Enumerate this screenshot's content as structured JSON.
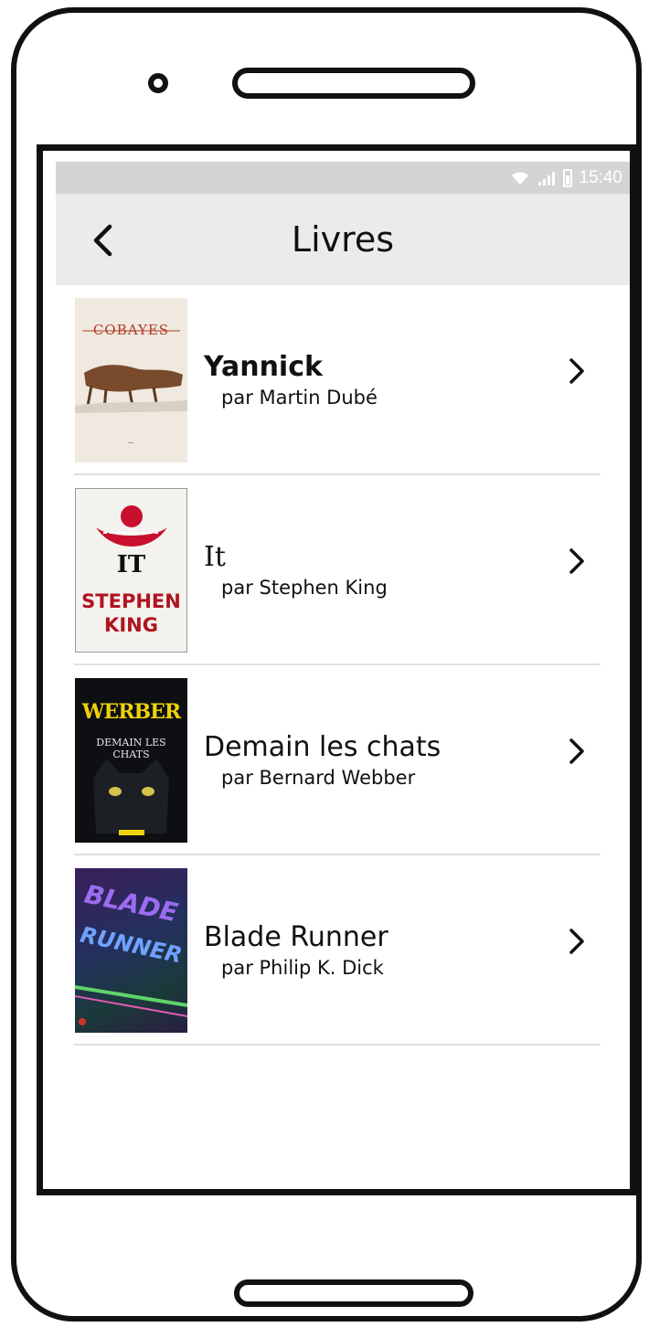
{
  "status_bar": {
    "time": "15:40",
    "icons": [
      "wifi-icon",
      "signal-icon",
      "battery-icon"
    ]
  },
  "app_bar": {
    "title": "Livres",
    "back_icon": "chevron-left-icon"
  },
  "books": [
    {
      "title": "Yannick",
      "author": "par Martin Dubé",
      "cover_text": "COBAYES"
    },
    {
      "title": "It",
      "author": "par Stephen King",
      "cover_text_top": "IT",
      "cover_text_bottom": "STEPHEN KING"
    },
    {
      "title": "Demain les chats",
      "author": "par Bernard Webber",
      "cover_text_top": "WERBER",
      "cover_text_bottom": "DEMAIN LES CHATS"
    },
    {
      "title": "Blade Runner",
      "author": "par Philip K. Dick",
      "cover_text_top": "BLADE",
      "cover_text_bottom": "RUNNER"
    }
  ],
  "colors": {
    "status_bar": "#d4d4d4",
    "app_bar": "#ebebeb",
    "frame": "#111111",
    "divider": "#e0e0e0"
  }
}
